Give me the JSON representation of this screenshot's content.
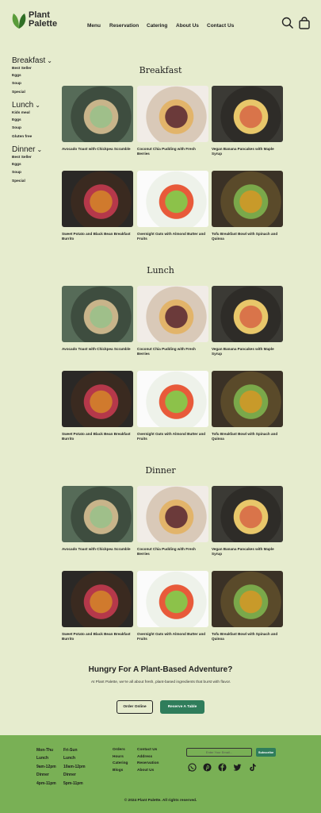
{
  "brand": {
    "line1": "Plant",
    "line2": "Palette",
    "leaf_color": "#3e7d2b"
  },
  "nav": [
    "Menu",
    "Reservation",
    "Catering",
    "About Us",
    "Contact Us"
  ],
  "header_icons": [
    "search-icon",
    "shopping-bag-icon"
  ],
  "sidebar": [
    {
      "heading": "Breakfast",
      "items": [
        "Best Seller",
        "Eggs",
        "Soup",
        "Special"
      ]
    },
    {
      "heading": "Lunch",
      "items": [
        "Kids meal",
        "Eggs",
        "Soup",
        "Gluten free"
      ]
    },
    {
      "heading": "Dinner",
      "items": [
        "Best Seller",
        "Eggs",
        "Soup",
        "Special"
      ]
    }
  ],
  "sections": [
    {
      "title": "Breakfast",
      "cards": [
        "Avocado Toast with Chickpea Scramble",
        "Coconut Chia Pudding with Fresh Berries",
        "Vegan Banana Pancakes with Maple Syrup",
        "Sweet Potato and Black Bean Breakfast Burrito",
        "Overnight Oats with Almond Butter and Fruits",
        "Tofu Breakfast Bowl with Spinach and Quinoa"
      ]
    },
    {
      "title": "Lunch",
      "cards": [
        "Avocado Toast with Chickpea Scramble",
        "Coconut Chia Pudding with Fresh Berries",
        "Vegan Banana Pancakes with Maple Syrup",
        "Sweet Potato and Black Bean Breakfast Burrito",
        "Overnight Oats with Almond Butter and Fruits",
        "Tofu Breakfast Bowl with Spinach and Quinoa"
      ]
    },
    {
      "title": "Dinner",
      "cards": [
        "Avocado Toast with Chickpea Scramble",
        "Coconut Chia Pudding with Fresh Berries",
        "Vegan Banana Pancakes with Maple Syrup",
        "Sweet Potato and Black Bean Breakfast Burrito",
        "Overnight Oats with Almond Butter and Fruits",
        "Tofu Breakfast Bowl with Spinach and Quinoa"
      ]
    }
  ],
  "cta": {
    "title": "Hungry For A Plant-Based Adventure?",
    "subtitle": "At Plant Palette, we're all about fresh, plant-based ingredients that burst with flavor.",
    "order_label": "Order Online",
    "reserve_label": "Reserve A Table"
  },
  "footer": {
    "hours_col1": [
      "Mon-Thu",
      "Lunch",
      "9am-12pm",
      "Dinner",
      "4pm-11pm"
    ],
    "hours_col2": [
      "Fri-Sun",
      "Lunch",
      "10am-12pm",
      "Dinner",
      "5pm-11pm"
    ],
    "links_col1": [
      "Orders",
      "Hours",
      "Catering",
      "Blogs"
    ],
    "links_col2": [
      "Contact Us",
      "Address",
      "Reservation",
      "About Us"
    ],
    "email_placeholder": "Enter Your Email...",
    "subscribe_label": "Subscribe",
    "social_icons": [
      "whatsapp-icon",
      "pinterest-icon",
      "facebook-icon",
      "twitter-icon",
      "tiktok-icon"
    ],
    "copyright": "© 2024 Plant Palette. All rights reserved."
  },
  "colors": {
    "background": "#e6ecce",
    "accent": "#2f7d5b",
    "footer": "#79b055"
  }
}
